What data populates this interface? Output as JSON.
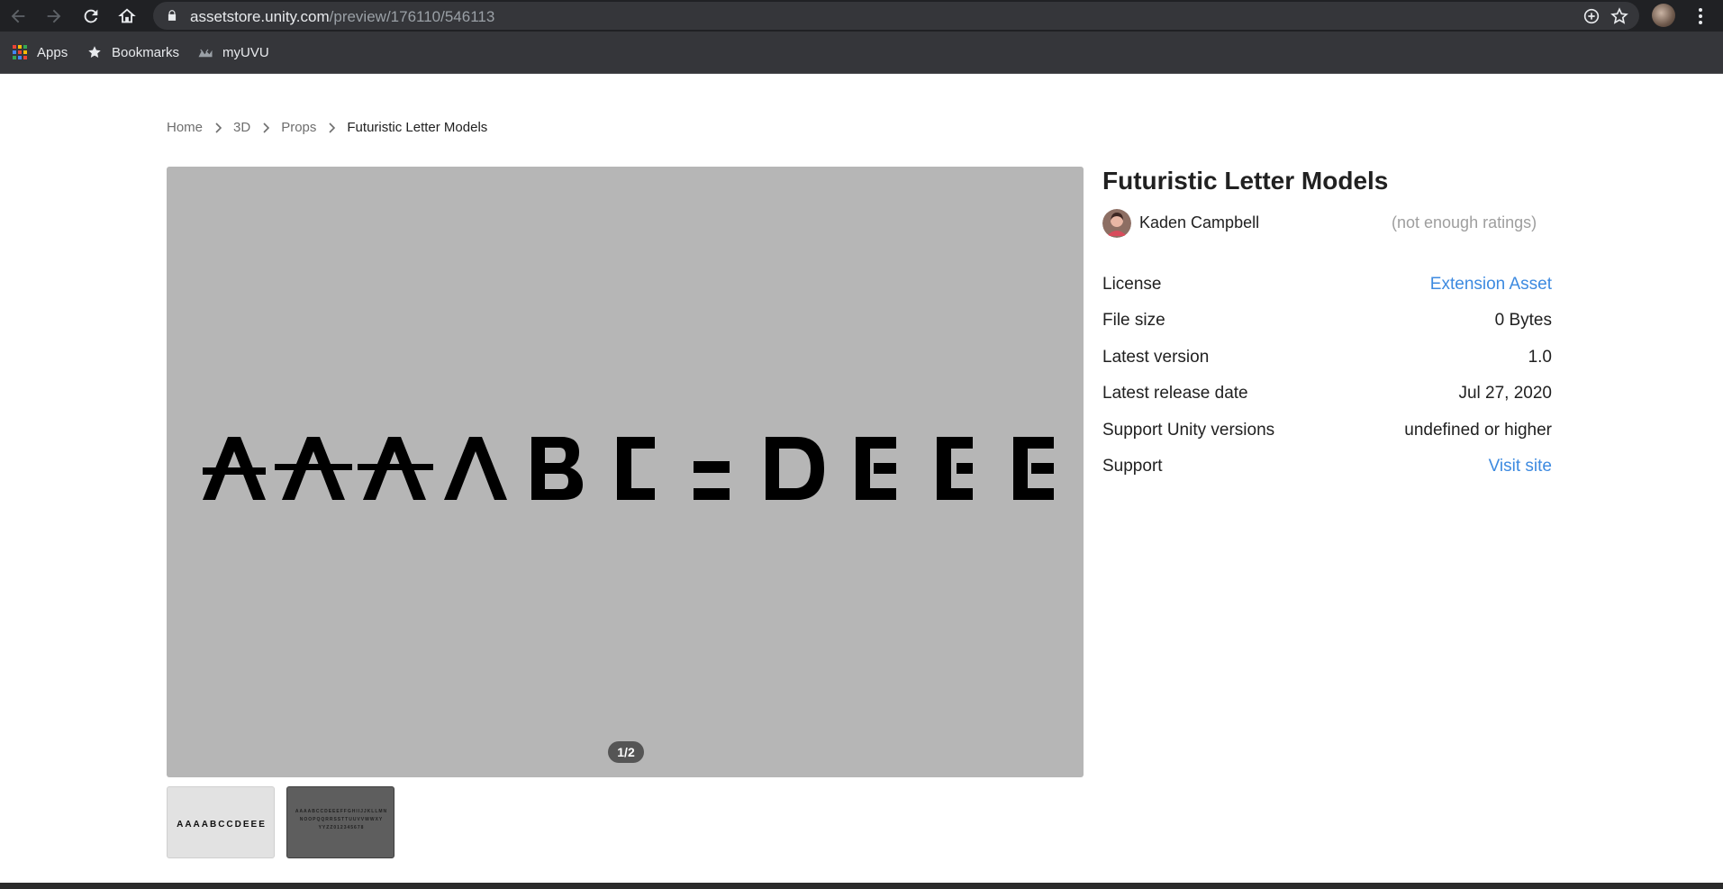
{
  "browser": {
    "url_host": "assetstore.unity.com",
    "url_path": "/preview/176110/546113",
    "bookmarks": [
      {
        "label": "Apps",
        "icon": "apps-grid-icon"
      },
      {
        "label": "Bookmarks",
        "icon": "star-icon"
      },
      {
        "label": "myUVU",
        "icon": "uvu-logo-icon"
      }
    ]
  },
  "breadcrumb": {
    "home": "Home",
    "level1": "3D",
    "level2": "Props",
    "current": "Futuristic Letter Models"
  },
  "gallery": {
    "counter": "1/2",
    "background": "#b6b6b6"
  },
  "asset": {
    "title": "Futuristic Letter Models",
    "author": "Kaden Campbell",
    "ratings": "(not enough ratings)",
    "details": [
      {
        "label": "License",
        "value": "Extension Asset",
        "link": true
      },
      {
        "label": "File size",
        "value": "0 Bytes",
        "link": false
      },
      {
        "label": "Latest version",
        "value": "1.0",
        "link": false
      },
      {
        "label": "Latest release date",
        "value": "Jul 27, 2020",
        "link": false
      },
      {
        "label": "Support Unity versions",
        "value": "undefined or higher",
        "link": false
      },
      {
        "label": "Support",
        "value": "Visit site",
        "link": true
      }
    ]
  },
  "colors": {
    "link": "#3d8ae0",
    "chrome_dark": "#202124",
    "bookmark_bar": "#35363a"
  }
}
